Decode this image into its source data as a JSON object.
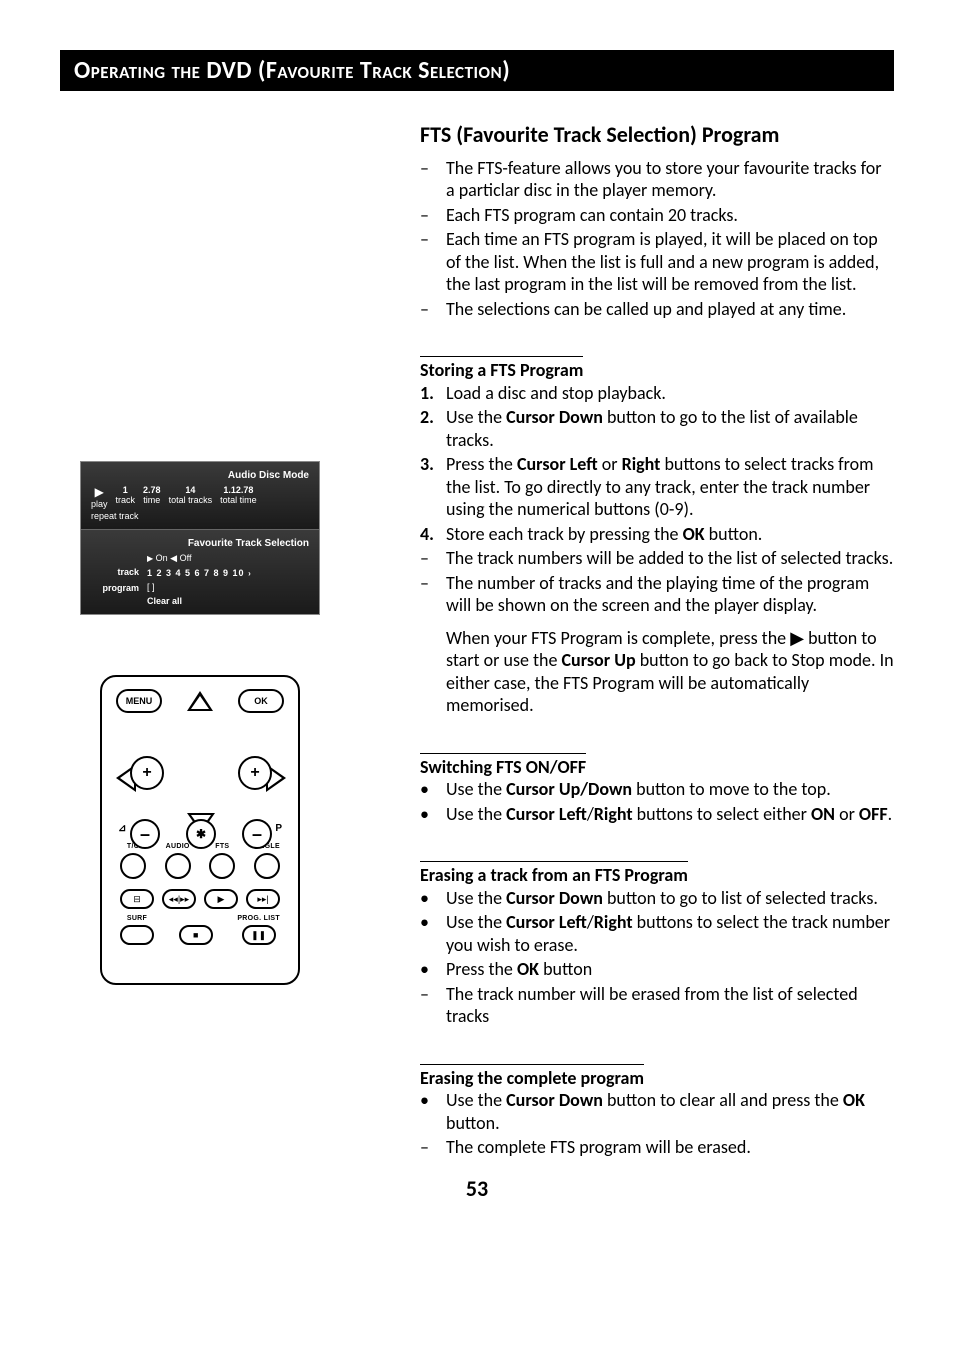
{
  "title": "Operating the DVD (Favourite Track Selection)",
  "page_number": "53",
  "main": {
    "heading": "FTS (Favourite Track Selection) Program",
    "intro": [
      "The FTS-feature allows you to store your favourite tracks for a particlar disc in the player memory.",
      "Each FTS program can contain 20 tracks.",
      "Each time an FTS program is played, it will be placed on top of the list. When the list is full and a new program is added, the last program in the list will be removed from the list.",
      "The selections can be called up and played at any time."
    ],
    "storing": {
      "heading": "Storing a FTS Program",
      "steps": {
        "s1": "Load a disc and stop playback.",
        "s2_a": "Use the ",
        "s2_b": "Cursor Down",
        "s2_c": " button to go to the list of available tracks.",
        "s3_a": "Press the ",
        "s3_b": "Cursor Left",
        "s3_c": " or ",
        "s3_d": "Right",
        "s3_e": " buttons to select tracks from the list. To go directly to any track, enter the track number using the numerical buttons (0-9).",
        "s4_a": "Store each track by pressing the ",
        "s4_b": "OK",
        "s4_c": " button.",
        "d1": "The track numbers will be added to the list of selected tracks.",
        "d2": "The number of tracks and the playing time of the program will be shown on the screen and the player display.",
        "note_a": "When your FTS Program is complete, press the ▶ button to start or use the ",
        "note_b": "Cursor Up",
        "note_c": " button to go back to Stop mode. In either case, the FTS Program will be automatically memorised."
      }
    },
    "switching": {
      "heading": "Switching FTS ON/OFF",
      "b1_a": "Use the ",
      "b1_b": "Cursor Up/Down",
      "b1_c": " button to move to the top.",
      "b2_a": "Use the ",
      "b2_b": "Cursor Left",
      "b2_c": "/",
      "b2_d": "Right",
      "b2_e": " buttons to select either ",
      "b2_f": "ON",
      "b2_g": " or ",
      "b2_h": "OFF",
      "b2_i": "."
    },
    "erasing_track": {
      "heading": "Erasing a track from an FTS Program",
      "b1_a": "Use the ",
      "b1_b": "Cursor Down",
      "b1_c": " button to go to list of selected tracks.",
      "b2_a": "Use the ",
      "b2_b": "Cursor Left",
      "b2_c": "/",
      "b2_d": "Right",
      "b2_e": " buttons to select the track number you wish to erase.",
      "b3_a": "Press the ",
      "b3_b": "OK",
      "b3_c": " button",
      "d1": "The track number will be erased from the list of selected tracks"
    },
    "erasing_program": {
      "heading": "Erasing the complete program",
      "b1_a": "Use the ",
      "b1_b": "Cursor Down",
      "b1_c": " button to clear all and press the ",
      "b1_d": "OK",
      "b1_e": " button.",
      "d1": "The complete FTS program will be erased."
    }
  },
  "osd": {
    "panel1_title": "Audio Disc Mode",
    "play_label": "play",
    "track_val": "1",
    "track_label": "track",
    "time_val": "2.78",
    "time_label": "time",
    "total_tracks_val": "14",
    "total_tracks_label": "total tracks",
    "total_time_val": "1.12.78",
    "total_time_label": "total time",
    "repeat": "repeat track",
    "panel2_title": "Favourite Track Selection",
    "onoff": "On ◀ Off",
    "track_row_label": "track",
    "track_numbers": "1  2  3  4  5  6  7  8  9  10",
    "program_label": "program",
    "program_val": "[ ]",
    "clear_all": "Clear all"
  },
  "remote": {
    "menu": "MENU",
    "ok": "OK",
    "vol_left": "⊿",
    "p_right": "P",
    "row_labels": {
      "tc": "T/C",
      "audio": "AUDIO",
      "fts": "FTS",
      "angle": "ANGLE"
    },
    "row2": {
      "surf": "SURF",
      "proglist": "PROG. LIST"
    }
  }
}
